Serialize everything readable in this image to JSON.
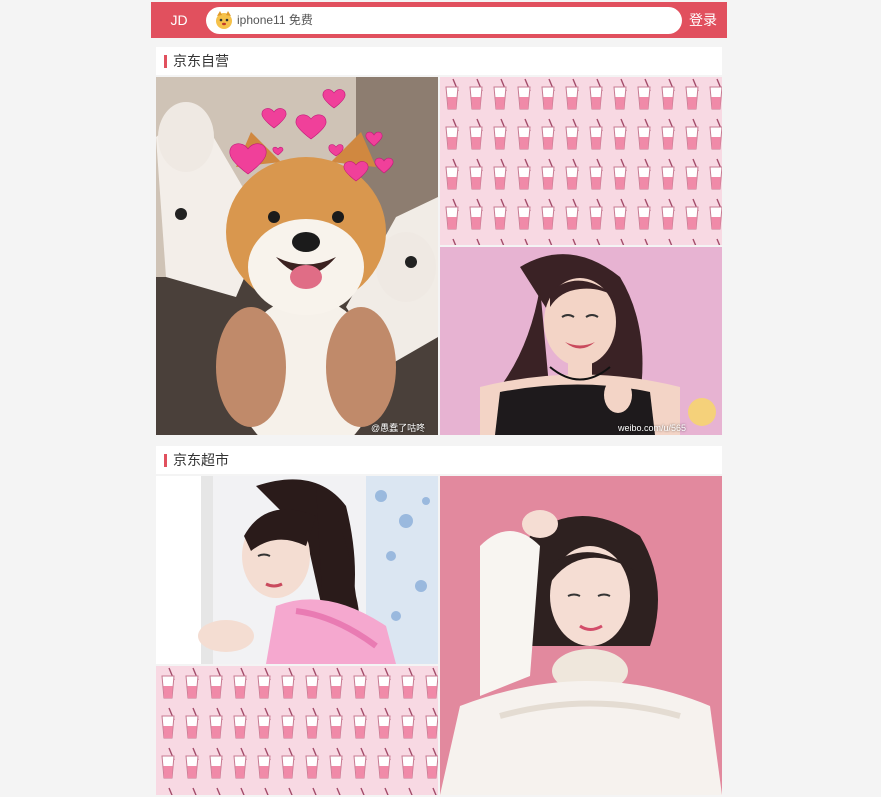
{
  "header": {
    "logo": "JD",
    "search_text": "iphone11 免费",
    "login": "登录"
  },
  "sections": [
    {
      "title": "京东自营",
      "tiles": [
        {
          "image": "shiba-dog-with-pink-hearts",
          "watermark": "@愚蠢了咕咚"
        },
        {
          "image": "pink-milk-tea-cup-pattern"
        },
        {
          "image": "smiling-woman-pink-background",
          "watermark": "weibo.com/u/565"
        }
      ]
    },
    {
      "title": "京东超市",
      "tiles": [
        {
          "image": "girl-with-ponytail-by-window"
        },
        {
          "image": "woman-white-lace-blouse-pink-background"
        },
        {
          "image": "pink-milk-tea-cup-pattern"
        }
      ]
    }
  ],
  "colors": {
    "brand": "#e1505e",
    "page_bg": "#f4f4f4",
    "pattern_pink": "#f8d9e3"
  }
}
